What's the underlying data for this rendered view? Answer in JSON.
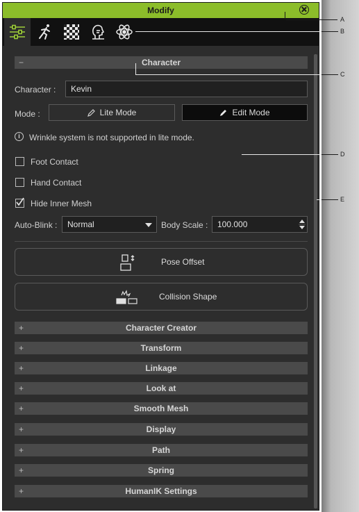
{
  "window": {
    "title": "Modify"
  },
  "tabs": [
    {
      "name": "modify-tab",
      "icon": "sliders-icon",
      "active": true
    },
    {
      "name": "motion-tab",
      "icon": "running-figure-icon",
      "active": false
    },
    {
      "name": "material-tab",
      "icon": "checker-icon",
      "active": false
    },
    {
      "name": "face-tab",
      "icon": "face-profile-icon",
      "active": false
    },
    {
      "name": "physics-tab",
      "icon": "atom-icon",
      "active": false
    }
  ],
  "character_section": {
    "title": "Character",
    "toggle": "−",
    "character_label": "Character :",
    "character_value": "Kevin",
    "mode_label": "Mode :",
    "lite_mode": "Lite Mode",
    "edit_mode": "Edit Mode",
    "info": "Wrinkle system is not supported in lite mode.",
    "foot_contact": {
      "label": "Foot Contact",
      "checked": false
    },
    "hand_contact": {
      "label": "Hand Contact",
      "checked": false
    },
    "hide_inner_mesh": {
      "label": "Hide Inner Mesh",
      "checked": true
    },
    "auto_blink_label": "Auto-Blink :",
    "auto_blink_value": "Normal",
    "body_scale_label": "Body Scale :",
    "body_scale_value": "100.000",
    "pose_offset": "Pose Offset",
    "collision_shape": "Collision Shape"
  },
  "collapsed_sections": [
    {
      "toggle": "+",
      "title": "Character Creator"
    },
    {
      "toggle": "+",
      "title": "Transform"
    },
    {
      "toggle": "+",
      "title": "Linkage"
    },
    {
      "toggle": "+",
      "title": "Look at"
    },
    {
      "toggle": "+",
      "title": "Smooth Mesh"
    },
    {
      "toggle": "+",
      "title": "Display"
    },
    {
      "toggle": "+",
      "title": "Path"
    },
    {
      "toggle": "+",
      "title": "Spring"
    },
    {
      "toggle": "+",
      "title": "HumanIK Settings"
    }
  ],
  "callouts": [
    "A",
    "B",
    "C",
    "D",
    "E"
  ],
  "colors": {
    "title_bar": "#8cbd2a",
    "panel": "#2d2d2d",
    "header": "#4a4a4a"
  }
}
